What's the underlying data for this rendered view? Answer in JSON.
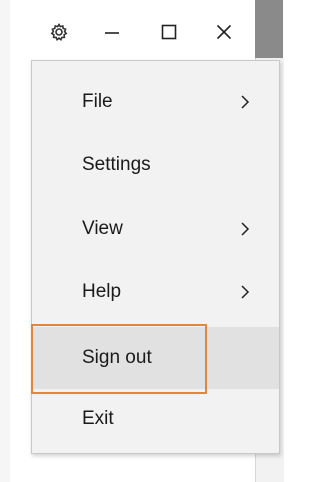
{
  "titlebar": {
    "icons": [
      "gear-icon",
      "minimize-icon",
      "maximize-icon",
      "close-icon"
    ]
  },
  "menu": {
    "items": [
      {
        "label": "File",
        "has_submenu": true
      },
      {
        "label": "Settings",
        "has_submenu": false
      },
      {
        "label": "View",
        "has_submenu": true
      },
      {
        "label": "Help",
        "has_submenu": true
      },
      {
        "label": "Sign out",
        "has_submenu": false,
        "hovered": true
      },
      {
        "label": "Exit",
        "has_submenu": false
      }
    ]
  },
  "colors": {
    "menu_background": "#f2f2f2",
    "hover_background": "#e1e1e1",
    "highlight_outline": "#e3863a",
    "text": "#1a1a1a"
  }
}
